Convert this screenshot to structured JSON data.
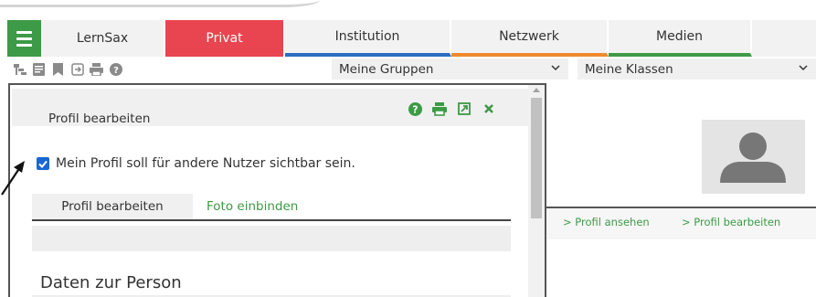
{
  "nav": {
    "menu_icon": "hamburger-icon",
    "tabs": [
      {
        "label": "LernSax",
        "accent": "#f2f2f2"
      },
      {
        "label": "Privat",
        "accent": "#e84550"
      },
      {
        "label": "Institution",
        "accent": "#2b6ec2"
      },
      {
        "label": "Netzwerk",
        "accent": "#ef8a2e"
      },
      {
        "label": "Medien",
        "accent": "#3d9a46"
      }
    ]
  },
  "toolbar": {
    "icons": [
      "tree-icon",
      "form-icon",
      "bookmark-icon",
      "export-icon",
      "print-icon",
      "help-icon"
    ],
    "groups_select": "Meine Gruppen",
    "classes_select": "Meine Klassen"
  },
  "dialog": {
    "title": "Profil bearbeiten",
    "actions": [
      "help-icon",
      "print-icon",
      "popout-icon",
      "close-icon"
    ],
    "checkbox": {
      "label": "Mein Profil soll für andere Nutzer sichtbar sein.",
      "checked": true
    },
    "tabs": [
      {
        "label": "Profil bearbeiten",
        "active": true
      },
      {
        "label": "Foto einbinden",
        "active": false
      }
    ],
    "section_title": "Daten zur Person"
  },
  "profile": {
    "avatar_icon": "user-silhouette-icon",
    "links": [
      "> Profil ansehen",
      "> Profil bearbeiten"
    ]
  },
  "colors": {
    "green": "#3d9a46",
    "red": "#e84550",
    "blue": "#2b6ec2",
    "orange": "#ef8a2e",
    "checkbox_blue": "#1967d2"
  }
}
